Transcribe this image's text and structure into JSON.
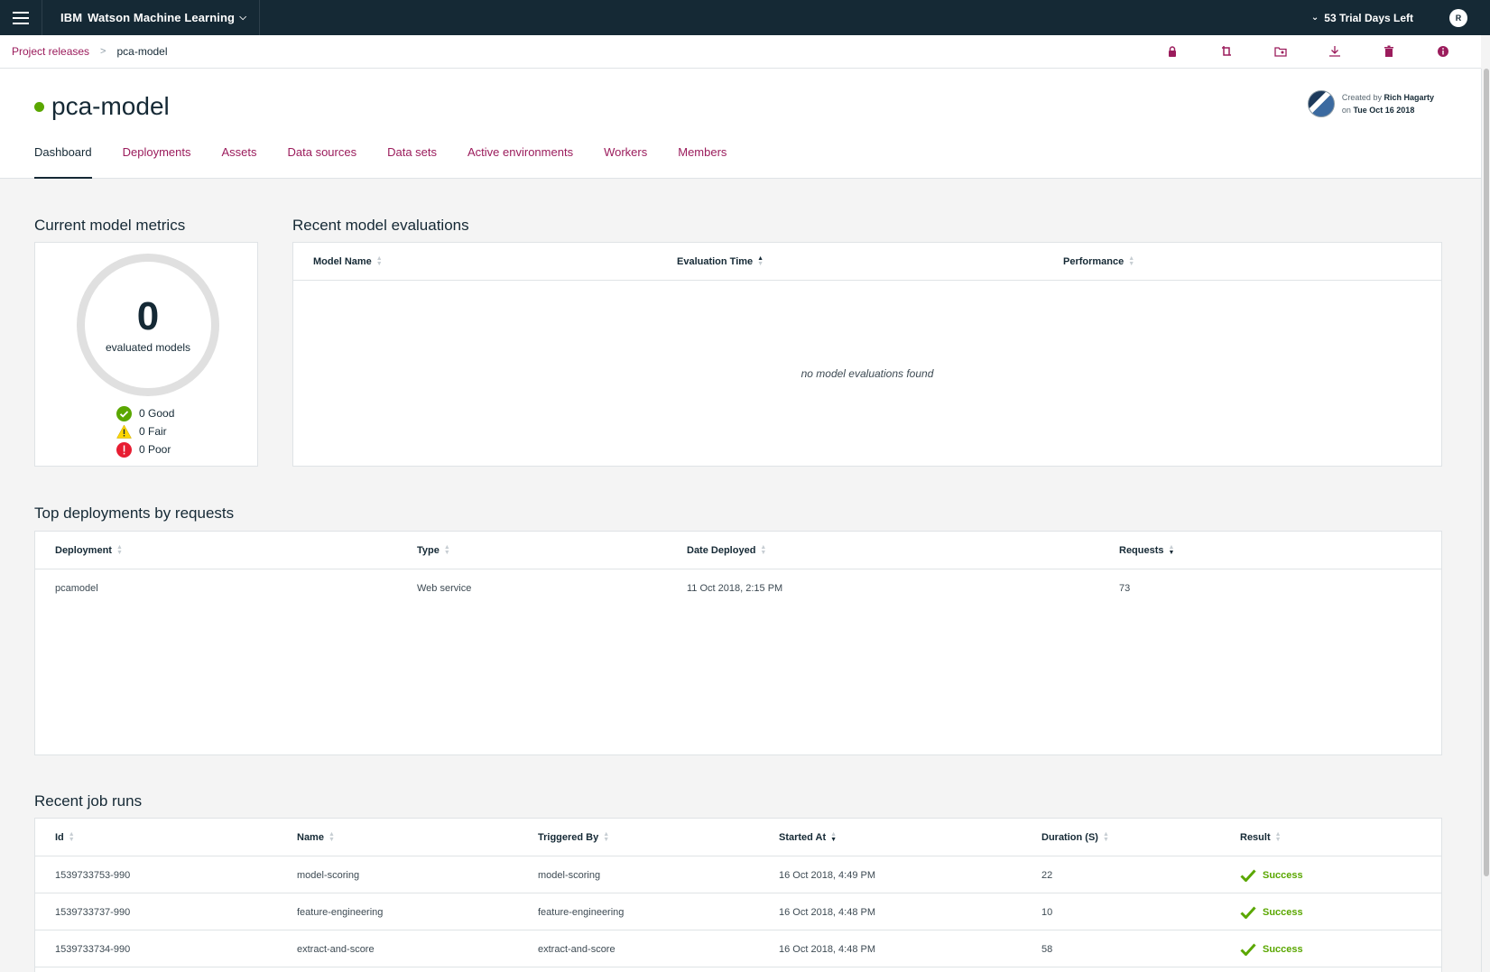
{
  "topbar": {
    "brand_prefix": "IBM",
    "brand_name": "Watson Machine Learning",
    "trial": "53 Trial Days Left",
    "avatar_initial": "R"
  },
  "breadcrumb": {
    "parent": "Project releases",
    "current": "pca-model",
    "actions": [
      "lock-icon",
      "branch-icon",
      "folder-settings-icon",
      "download-icon",
      "trash-icon",
      "info-icon"
    ]
  },
  "header": {
    "title": "pca-model",
    "status_color": "#5aa700",
    "created_by_label": "Created by",
    "created_by": "Rich Hagarty",
    "created_on_label": "on",
    "created_on": "Tue Oct 16 2018"
  },
  "tabs": [
    "Dashboard",
    "Deployments",
    "Assets",
    "Data sources",
    "Data sets",
    "Active environments",
    "Workers",
    "Members"
  ],
  "active_tab": "Dashboard",
  "metrics": {
    "title": "Current model metrics",
    "count": "0",
    "count_label": "evaluated models",
    "good": "0 Good",
    "fair": "0 Fair",
    "poor": "0 Poor"
  },
  "evaluations": {
    "title": "Recent model evaluations",
    "columns": [
      "Model Name",
      "Evaluation Time",
      "Performance"
    ],
    "empty": "no model evaluations found"
  },
  "deployments": {
    "title": "Top deployments by requests",
    "columns": [
      "Deployment",
      "Type",
      "Date Deployed",
      "Requests"
    ],
    "rows": [
      [
        "pcamodel",
        "Web service",
        "11 Oct 2018, 2:15 PM",
        "73"
      ]
    ]
  },
  "jobs": {
    "title": "Recent job runs",
    "columns": [
      "Id",
      "Name",
      "Triggered By",
      "Started At",
      "Duration (S)",
      "Result"
    ],
    "rows": [
      [
        "1539733753-990",
        "model-scoring",
        "model-scoring",
        "16 Oct 2018, 4:49 PM",
        "22",
        "Success"
      ],
      [
        "1539733737-990",
        "feature-engineering",
        "feature-engineering",
        "16 Oct 2018, 4:48 PM",
        "10",
        "Success"
      ],
      [
        "1539733734-990",
        "extract-and-score",
        "extract-and-score",
        "16 Oct 2018, 4:48 PM",
        "58",
        "Success"
      ]
    ]
  },
  "colors": {
    "accent": "#9b1c5c",
    "nav": "#152935",
    "good": "#5aa700",
    "fair": "#fdd600",
    "poor": "#e71d32"
  }
}
